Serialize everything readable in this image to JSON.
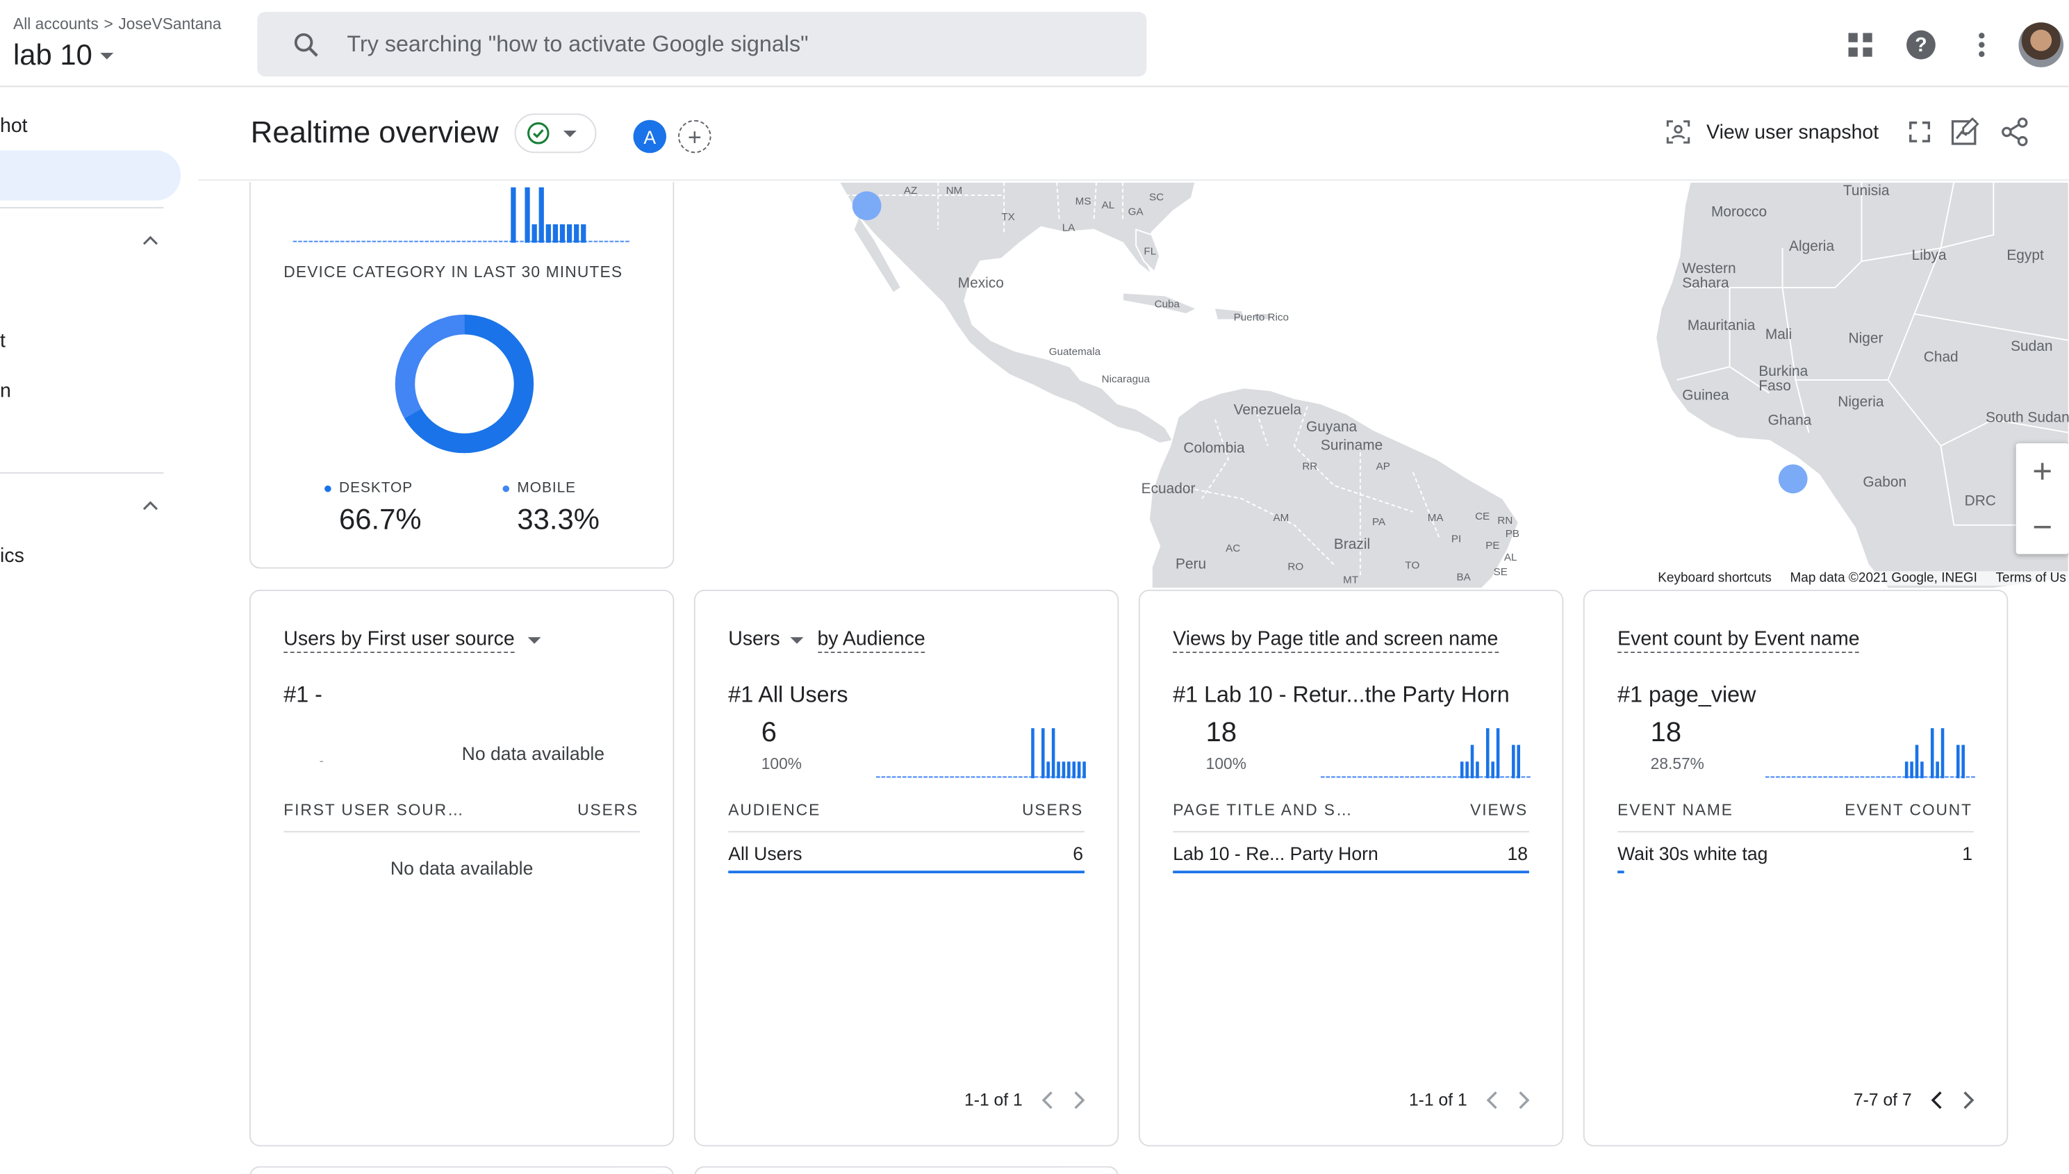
{
  "header": {
    "crumb_root": "All accounts",
    "crumb_sep": ">",
    "crumb_account": "JoseVSantana",
    "property": "lab 10",
    "search_placeholder": "Try searching \"how to activate Google signals\""
  },
  "nav": {
    "item_snapshot": "hot",
    "item_t": "t",
    "item_n": "n",
    "item_ics": "ics"
  },
  "page": {
    "title": "Realtime overview",
    "comparison_chip": "A",
    "view_snapshot": "View user snapshot"
  },
  "map": {
    "labels": {
      "az": "AZ",
      "nm": "NM",
      "ms": "MS",
      "al": "AL",
      "ga": "GA",
      "sc": "SC",
      "tx": "TX",
      "la": "LA",
      "fl": "FL",
      "mexico": "Mexico",
      "cuba": "Cuba",
      "puerto_rico": "Puerto Rico",
      "guatemala": "Guatemala",
      "nicaragua": "Nicaragua",
      "venezuela": "Venezuela",
      "guyana": "Guyana",
      "suriname": "Suriname",
      "colombia": "Colombia",
      "rr": "RR",
      "ap": "AP",
      "ecuador": "Ecuador",
      "am": "AM",
      "pa": "PA",
      "ma": "MA",
      "ce": "CE",
      "rn": "RN",
      "pb": "PB",
      "pi": "PI",
      "pe_state": "PE",
      "brazil": "Brazil",
      "al_br": "AL",
      "ac": "AC",
      "ro": "RO",
      "to": "TO",
      "se": "SE",
      "peru": "Peru",
      "mt": "MT",
      "ba": "BA",
      "tunisia": "Tunisia",
      "morocco": "Morocco",
      "algeria": "Algeria",
      "libya": "Libya",
      "egypt": "Egypt",
      "western_sahara": "Western\nSahara",
      "mauritania": "Mauritania",
      "mali": "Mali",
      "niger": "Niger",
      "chad": "Chad",
      "sudan": "Sudan",
      "burkina_faso": "Burkina\nFaso",
      "guinea": "Guinea",
      "ghana": "Ghana",
      "nigeria": "Nigeria",
      "south_sudan": "South Sudan",
      "gabon": "Gabon",
      "drc": "DRC"
    },
    "footer_shortcuts": "Keyboard shortcuts",
    "footer_data": "Map data ©2021 Google, INEGI",
    "footer_terms": "Terms of Us"
  },
  "device_card": {
    "title": "DEVICE CATEGORY IN LAST 30 MINUTES",
    "desktop_label": "DESKTOP",
    "desktop_value": "66.7%",
    "mobile_label": "MOBILE",
    "mobile_value": "33.3%",
    "desktop_share": 0.667,
    "mobile_share": 0.333,
    "desktop_color": "#1a73e8",
    "mobile_color": "#4285f4"
  },
  "cards": [
    {
      "title_a": "Users by First user source",
      "rank": "#1  -",
      "nodata_chart": "No data available",
      "dash": "-",
      "col1": "FIRST USER SOUR…",
      "col2": "USERS",
      "nodata_table": "No data available"
    },
    {
      "title_a": "Users",
      "title_b": "by Audience",
      "rank": "#1  All Users",
      "number": "6",
      "pct": "100%",
      "col1": "AUDIENCE",
      "col2": "USERS",
      "row_label": "All Users",
      "row_value": "6",
      "row_share": 1.0,
      "pager": "1-1 of 1",
      "sparkline": [
        0,
        0,
        0,
        0,
        0,
        0,
        0,
        0,
        0,
        0,
        0,
        0,
        0,
        0,
        0,
        0,
        0,
        0,
        0,
        0,
        0,
        0,
        0,
        0,
        0,
        0,
        0,
        0,
        0,
        0,
        3,
        0,
        3,
        1,
        3,
        1,
        1,
        1,
        1,
        1,
        1
      ]
    },
    {
      "title_a": "Views by Page title and screen name",
      "rank": "#1  Lab 10 - Retur...the Party Horn",
      "number": "18",
      "pct": "100%",
      "col1": "PAGE TITLE AND S…",
      "col2": "VIEWS",
      "row_label": "Lab 10 - Re... Party Horn",
      "row_value": "18",
      "row_share": 1.0,
      "pager": "1-1 of 1",
      "sparkline": [
        0,
        0,
        0,
        0,
        0,
        0,
        0,
        0,
        0,
        0,
        0,
        0,
        0,
        0,
        0,
        0,
        0,
        0,
        0,
        0,
        0,
        0,
        0,
        0,
        0,
        0,
        0,
        1,
        1,
        2,
        1,
        0,
        3,
        1,
        3,
        0,
        0,
        2,
        2,
        0,
        0
      ]
    },
    {
      "title_a": "Event count by Event name",
      "rank": "#1  page_view",
      "number": "18",
      "pct": "28.57%",
      "col1": "EVENT NAME",
      "col2": "EVENT COUNT",
      "row_label": "Wait 30s white tag",
      "row_value": "1",
      "row_share": 0.02,
      "pager": "7-7 of 7",
      "sparkline": [
        0,
        0,
        0,
        0,
        0,
        0,
        0,
        0,
        0,
        0,
        0,
        0,
        0,
        0,
        0,
        0,
        0,
        0,
        0,
        0,
        0,
        0,
        0,
        0,
        0,
        0,
        0,
        1,
        1,
        2,
        1,
        0,
        3,
        1,
        3,
        0,
        0,
        2,
        2,
        0,
        0
      ]
    }
  ],
  "top_sparkline": [
    0,
    0,
    0,
    0,
    0,
    0,
    0,
    0,
    0,
    0,
    0,
    0,
    0,
    0,
    0,
    0,
    0,
    0,
    0,
    0,
    0,
    0,
    0,
    0,
    0,
    0,
    0,
    0,
    0,
    0,
    0,
    3,
    0,
    3,
    1,
    3,
    1,
    1,
    1,
    1,
    1,
    1,
    0,
    0,
    0,
    0,
    0,
    0
  ],
  "colors": {
    "accent": "#1a73e8",
    "green_check": "#188038",
    "map_land": "#dadcdf",
    "map_dot": "#7baaf7"
  },
  "icons": [
    "search-icon",
    "apps-grid-icon",
    "help-icon",
    "more-vert-icon",
    "chevron-up-icon",
    "check-circle-icon",
    "add-icon",
    "user-snapshot-icon",
    "fullscreen-icon",
    "customize-icon",
    "share-icon",
    "chevron-left-icon",
    "chevron-right-icon",
    "zoom-in-icon",
    "zoom-out-icon"
  ]
}
